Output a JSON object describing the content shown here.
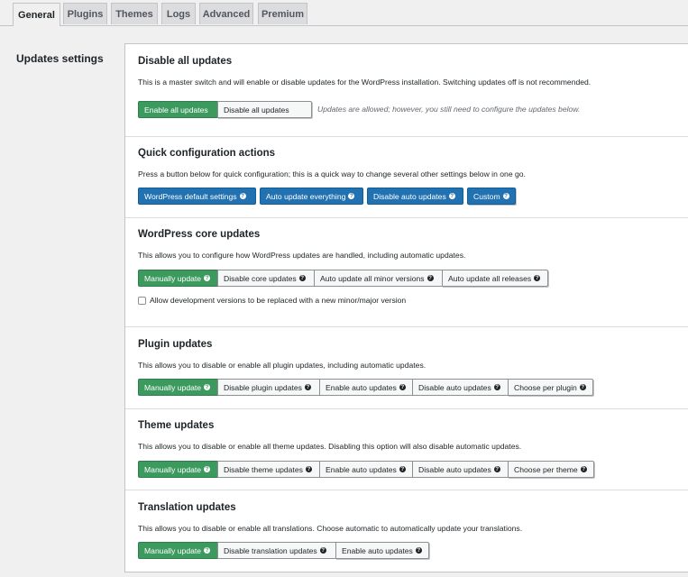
{
  "tabs": [
    "General",
    "Plugins",
    "Themes",
    "Logs",
    "Advanced",
    "Premium"
  ],
  "active_tab": "General",
  "side_title": "Updates settings",
  "sections": {
    "disable": {
      "title": "Disable all updates",
      "desc": "This is a master switch and will enable or disable updates for the WordPress installation. Switching updates off is not recommended.",
      "buttons": [
        "Enable all updates",
        "Disable all updates"
      ],
      "note": "Updates are allowed; however, you still need to configure the updates below."
    },
    "quick": {
      "title": "Quick configuration actions",
      "desc": "Press a button below for quick configuration; this is a quick way to change several other settings below in one go.",
      "buttons": [
        "WordPress default settings",
        "Auto update everything",
        "Disable auto updates",
        "Custom"
      ]
    },
    "core": {
      "title": "WordPress core updates",
      "desc": "This allows you to configure how WordPress updates are handled, including automatic updates.",
      "buttons": [
        "Manually update",
        "Disable core updates",
        "Auto update all minor versions",
        "Auto update all releases"
      ],
      "checkbox": "Allow development versions to be replaced with a new minor/major version"
    },
    "plugin": {
      "title": "Plugin updates",
      "desc": "This allows you to disable or enable all plugin updates, including automatic updates.",
      "buttons": [
        "Manually update",
        "Disable plugin updates",
        "Enable auto updates",
        "Disable auto updates",
        "Choose per plugin"
      ]
    },
    "theme": {
      "title": "Theme updates",
      "desc": "This allows you to disable or enable all theme updates. Disabling this option will also disable automatic updates.",
      "buttons": [
        "Manually update",
        "Disable theme updates",
        "Enable auto updates",
        "Disable auto updates",
        "Choose per theme"
      ]
    },
    "translation": {
      "title": "Translation updates",
      "desc": "This allows you to disable or enable all translations. Choose automatic to automatically update your translations.",
      "buttons": [
        "Manually update",
        "Disable translation updates",
        "Enable auto updates"
      ]
    }
  },
  "colors": {
    "green": "#3c9a5f",
    "blue": "#2271b1"
  }
}
